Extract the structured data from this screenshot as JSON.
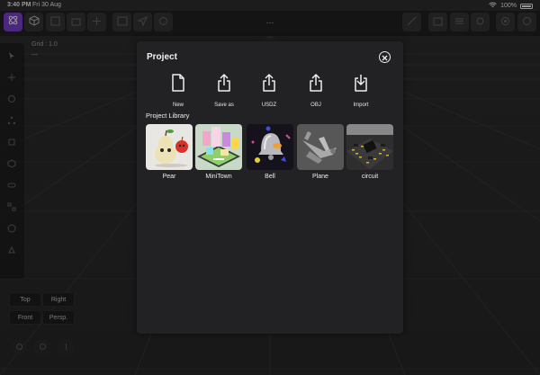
{
  "status_bar": {
    "time": "3:40 PM",
    "date": "Fri 30 Aug",
    "battery": "100%"
  },
  "toolbar": {
    "title": "---"
  },
  "viewport": {
    "grid_label": "Grid : 1.0",
    "grid_sub": "---"
  },
  "view_buttons": [
    {
      "id": "top",
      "label": "Top"
    },
    {
      "id": "right",
      "label": "Right"
    },
    {
      "id": "front",
      "label": "Front"
    },
    {
      "id": "persp",
      "label": "Persp."
    }
  ],
  "modal": {
    "title": "Project",
    "actions": [
      {
        "id": "new",
        "label": "New",
        "icon": "new-document-icon"
      },
      {
        "id": "save-as",
        "label": "Save as",
        "icon": "share-icon"
      },
      {
        "id": "usdz",
        "label": "USDZ",
        "icon": "share-icon"
      },
      {
        "id": "obj",
        "label": "OBJ",
        "icon": "share-icon"
      },
      {
        "id": "import",
        "label": "Import",
        "icon": "import-icon"
      }
    ],
    "library_title": "Project Library",
    "library": [
      {
        "id": "pear",
        "name": "Pear"
      },
      {
        "id": "minitown",
        "name": "MiniTown"
      },
      {
        "id": "bell",
        "name": "Bell"
      },
      {
        "id": "plane",
        "name": "Plane"
      },
      {
        "id": "circuit",
        "name": "circuit"
      }
    ]
  },
  "colors": {
    "accent": "#7a3fd0",
    "modal_bg": "#222224",
    "toolbar_bg": "#1f1f1f"
  }
}
